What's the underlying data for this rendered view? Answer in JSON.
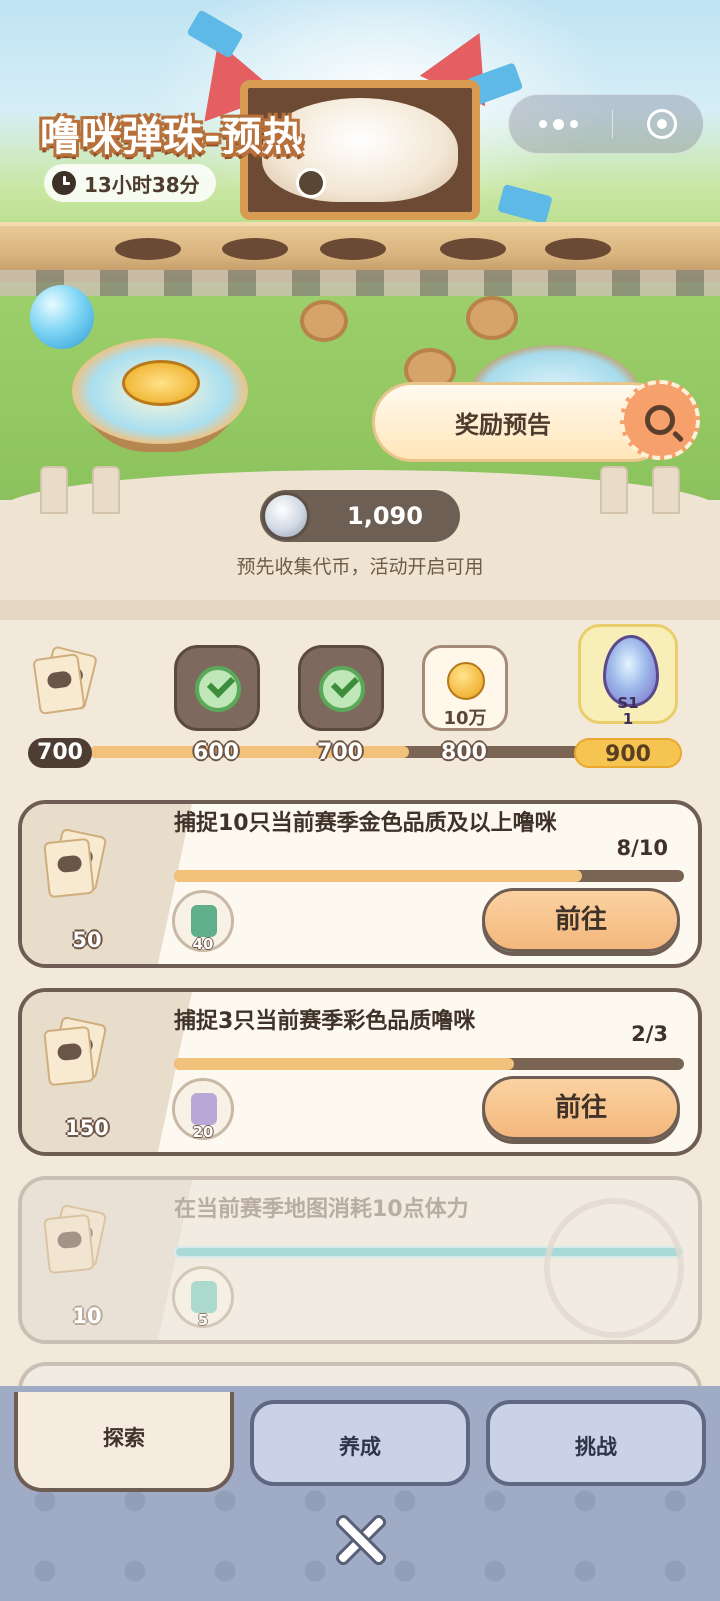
{
  "header": {
    "title": "噜咪弹珠-预热",
    "timer": "13小时38分"
  },
  "reward_preview": {
    "label": "奖励预告"
  },
  "token": {
    "value": "1,090",
    "note": "预先收集代币，活动开启可用"
  },
  "milestones": {
    "current": "700",
    "progress_fraction": 0.54,
    "nodes": [
      {
        "threshold": "600",
        "state": "claimed"
      },
      {
        "threshold": "700",
        "state": "claimed"
      },
      {
        "threshold": "800",
        "state": "available",
        "amount": "10万"
      },
      {
        "threshold": "900",
        "state": "locked",
        "tag_line1": "S1",
        "tag_line2": "1"
      }
    ]
  },
  "quests": [
    {
      "title": "捕捉10只当前赛季金色品质及以上噜咪",
      "progress": "8/10",
      "progress_fraction": 0.8,
      "ticket_reward": "50",
      "item_reward": "40",
      "item_icon": "card-icon",
      "button": "前往",
      "state": "active"
    },
    {
      "title": "捕捉3只当前赛季彩色品质噜咪",
      "progress": "2/3",
      "progress_fraction": 0.667,
      "ticket_reward": "150",
      "item_reward": "20",
      "item_icon": "cat-token-icon",
      "button": "前往",
      "state": "active"
    },
    {
      "title": "在当前赛季地图消耗10点体力",
      "progress": "",
      "progress_fraction": 1.0,
      "ticket_reward": "10",
      "item_reward": "5",
      "item_icon": "lightning-icon",
      "button": "",
      "state": "completed"
    }
  ],
  "tabs": [
    {
      "label": "探索",
      "active": true
    },
    {
      "label": "养成",
      "active": false
    },
    {
      "label": "挑战",
      "active": false
    }
  ],
  "colors": {
    "accent": "#f2c27a",
    "border": "#6e5d52",
    "tabbar": "#a0abc5"
  }
}
